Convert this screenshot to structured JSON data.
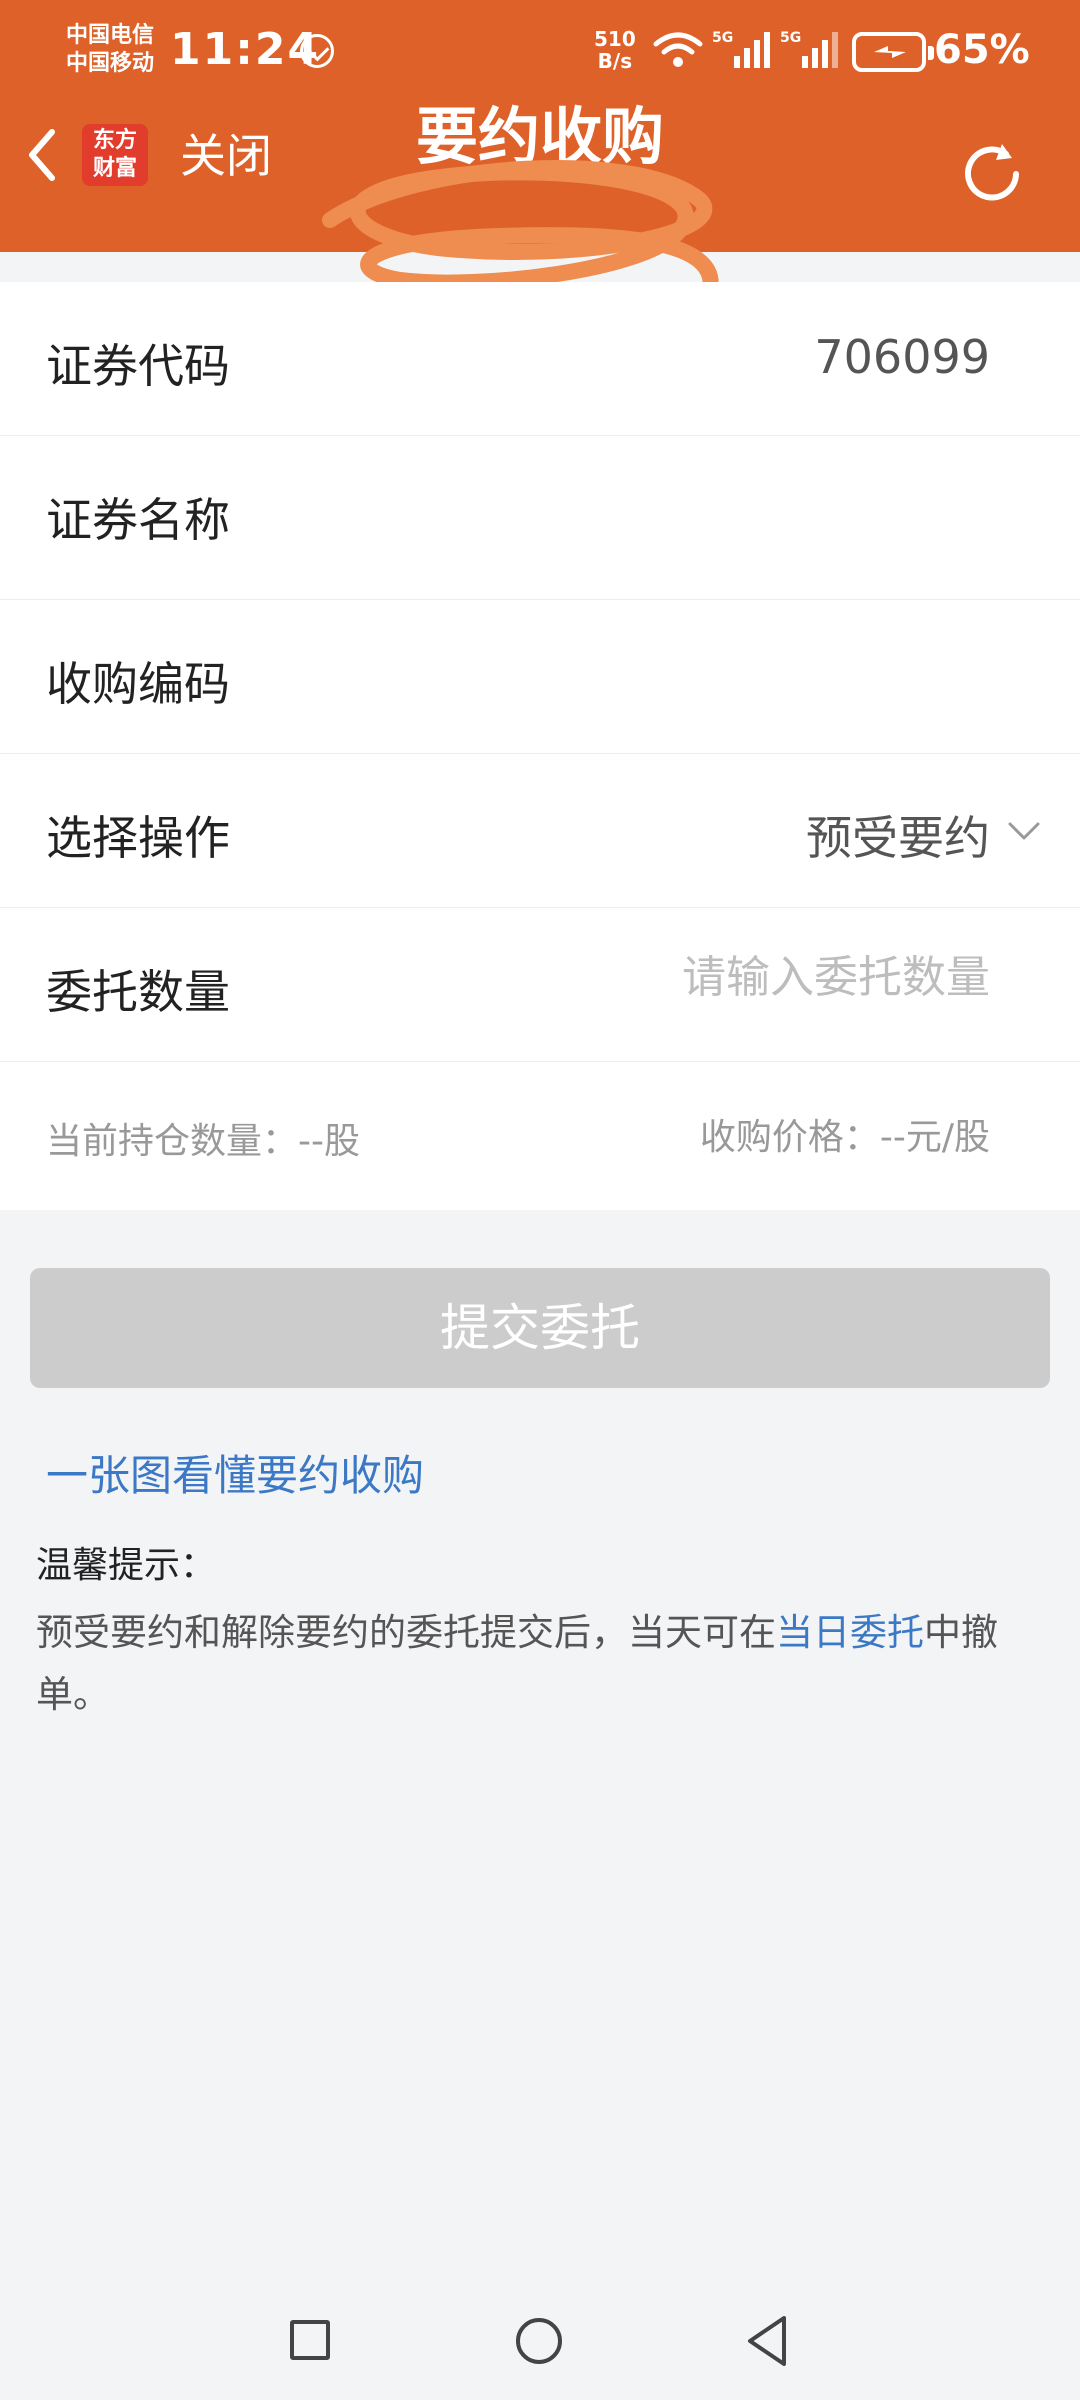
{
  "status_bar": {
    "carrier_1": "中国电信",
    "carrier_2": "中国移动",
    "time": "11:24",
    "net_speed_value": "510",
    "net_speed_unit": "B/s",
    "signal_1": "5G",
    "signal_2": "5G",
    "battery": "65%"
  },
  "header": {
    "logo_line1": "东方",
    "logo_line2": "财富",
    "close_label": "关闭",
    "title": "要约收购",
    "subtitle": "",
    "accent_color": "#dd6128"
  },
  "form": {
    "rows": [
      {
        "label": "证券代码",
        "value": "706099"
      },
      {
        "label": "证券名称",
        "value": ""
      },
      {
        "label": "收购编码",
        "value": ""
      },
      {
        "label": "选择操作",
        "value": "预受要约"
      },
      {
        "label": "委托数量",
        "value": "",
        "placeholder": "请输入委托数量"
      }
    ],
    "holding_label": "当前持仓数量：--股",
    "price_label": "收购价格：--元/股"
  },
  "actions": {
    "submit_label": "提交委托",
    "guide_link": "一张图看懂要约收购"
  },
  "tips": {
    "title": "温馨提示：",
    "body_prefix": "预受要约和解除要约的委托提交后，当天可在",
    "body_link": "当日委托",
    "body_suffix": "中撤单。",
    "link_color": "#3b78c5"
  },
  "icons": {
    "back": "chevron-left-icon",
    "refresh": "refresh-icon",
    "dropdown": "chevron-down-icon",
    "nav_recent": "square-icon",
    "nav_home": "circle-icon",
    "nav_back": "triangle-back-icon"
  }
}
